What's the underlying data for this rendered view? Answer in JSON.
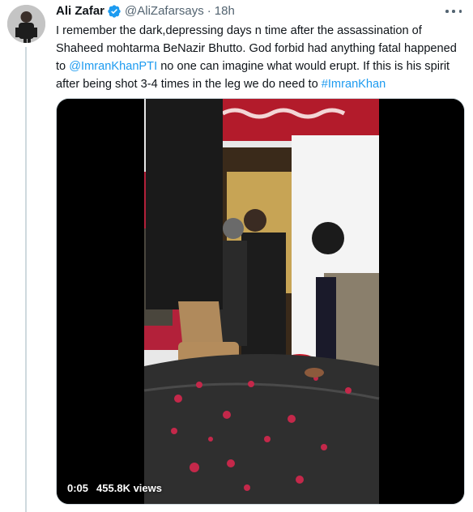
{
  "tweet": {
    "author_name": "Ali Zafar",
    "handle": "@AliZafarsays",
    "separator": "·",
    "time": "18h",
    "text_prefix": "I remember the dark,depressing days n time after the assassination of Shaheed mohtarma BeNazir Bhutto. God forbid had anything fatal happened to ",
    "mention": "@ImranKhanPTI",
    "text_middle": " no one can imagine what would erupt. If this is his spirit after being shot 3-4 times in the leg we do need to ",
    "hashtag": "#ImranKhan",
    "verified_icon": "verified-badge-icon",
    "more_icon": "more-options-icon"
  },
  "media": {
    "elapsed": "0:05",
    "views": "455.8K views"
  },
  "colors": {
    "link": "#1d9bf0",
    "secondary_text": "#536471",
    "verified": "#1d9bf0"
  }
}
